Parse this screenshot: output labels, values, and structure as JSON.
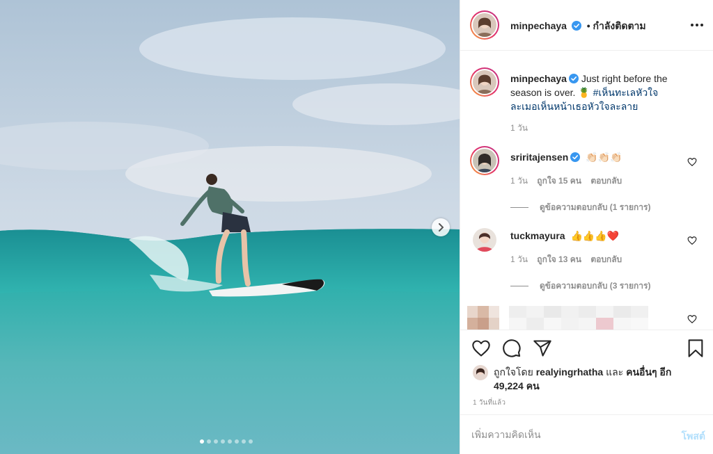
{
  "post": {
    "username": "minpechaya",
    "follow_separator": "•",
    "follow_state": "กำลังติดตาม",
    "caption": {
      "username": "minpechaya",
      "text": "Just right before the season is over.",
      "emoji": "🍍",
      "hashtag": "#เห็นทะเลหัวใจละเมอเห็นหน้าเธอหัวใจละลาย",
      "time": "1 วัน"
    },
    "comments": [
      {
        "username": "sriritajensen",
        "text": "👏🏻👏🏻👏🏻",
        "time": "1 วัน",
        "likes": "ถูกใจ 15 คน",
        "reply_label": "ตอบกลับ",
        "view_replies": "ดูข้อความตอบกลับ (1 รายการ)"
      },
      {
        "username": "tuckmayura",
        "text": "👍👍👍❤️",
        "time": "1 วัน",
        "likes": "ถูกใจ 13 คน",
        "reply_label": "ตอบกลับ",
        "view_replies": "ดูข้อความตอบกลับ (3 รายการ)"
      }
    ],
    "liked_by_prefix": "ถูกใจโดย",
    "liked_by_user": "realyingrhatha",
    "liked_by_and": "และ",
    "liked_by_others": "คนอื่นๆ อีก 49,224 คน",
    "timestamp": "1 วันที่แล้ว",
    "add_comment_placeholder": "เพิ่มความคิดเห็น",
    "post_button": "โพสต์",
    "carousel": {
      "count": 8,
      "active": 0
    }
  },
  "icons": {
    "verified": "verified-badge-icon",
    "more": "more-options-icon",
    "like": "heart-icon",
    "comment": "comment-icon",
    "share": "share-icon",
    "save": "bookmark-icon",
    "next": "chevron-right-icon"
  },
  "colors": {
    "verified": "#3897f0",
    "link": "#00376b",
    "secondary_text": "#8e8e8e",
    "post_button_disabled": "#b2dffc",
    "like_heart_red": "#ed4956"
  }
}
